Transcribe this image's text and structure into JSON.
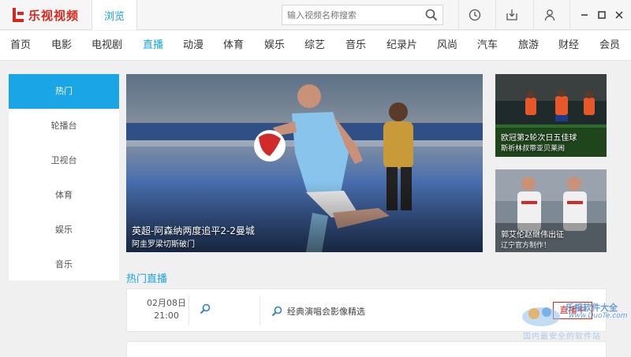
{
  "app": {
    "logo_text": "乐视视频",
    "browse_tab": "浏览"
  },
  "search": {
    "placeholder": "输入视频名称搜索",
    "value": ""
  },
  "toolbar_icons": [
    "clock-icon",
    "download-icon",
    "user-icon"
  ],
  "window_icons": [
    "minimize-icon",
    "maximize-icon",
    "close-icon"
  ],
  "nav": {
    "items": [
      "首页",
      "电影",
      "电视剧",
      "直播",
      "动漫",
      "体育",
      "娱乐",
      "综艺",
      "音乐",
      "纪录片",
      "风尚",
      "汽车",
      "旅游",
      "财经",
      "会员"
    ],
    "active": "直播"
  },
  "sidebar": {
    "items": [
      "热门",
      "轮播台",
      "卫视台",
      "体育",
      "娱乐",
      "音乐"
    ],
    "active": "热门"
  },
  "hero": {
    "title": "英超-阿森纳两度追平2-2曼城",
    "subtitle": "阿圭罗梁切斯破门"
  },
  "thumbs": [
    {
      "title": "欧冠第2轮次日五佳球",
      "subtitle": "斯祈林叔带亚贝莱闹",
      "icon": "soccer-thumbnail"
    },
    {
      "title": "郭艾伦赵继伟出征",
      "subtitle": "辽宁官方制作！",
      "icon": "basketball-thumbnail"
    }
  ],
  "live_section": {
    "title": "热门直播",
    "rows": [
      {
        "date": "02月08日",
        "time": "21:00",
        "program": "经典演唱会影像精选",
        "status": "直播中"
      }
    ]
  },
  "watermark": {
    "line1": "乐视软件大全",
    "line2": "www.DuoTe.com",
    "line3": "国内最安全的软件站"
  },
  "colors": {
    "accent": "#19a5e6",
    "brand": "#d9261c"
  }
}
